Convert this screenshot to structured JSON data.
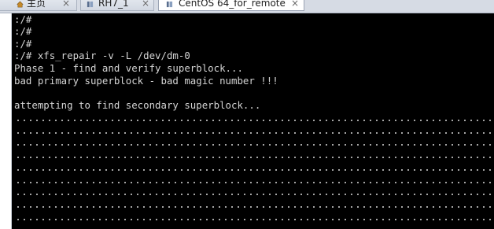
{
  "tabs": [
    {
      "label": "主页",
      "active": false,
      "icon": "home-icon"
    },
    {
      "label": "RH7_1",
      "active": false,
      "icon": "vm-icon"
    },
    {
      "label": "CentOS 64_for_remote",
      "active": true,
      "icon": "vm-icon"
    }
  ],
  "terminal": {
    "lines": [
      ":/#",
      ":/#",
      ":/#",
      ":/# xfs_repair -v -L /dev/dm-0",
      "Phase 1 - find and verify superblock...",
      "bad primary superblock - bad magic number !!!",
      "",
      "attempting to find secondary superblock..."
    ],
    "progress_dot_rows": 9
  },
  "colors": {
    "terminal_bg": "#000000",
    "terminal_fg": "#d4d4d4",
    "tabbar_bg": "#d6dbe4"
  }
}
